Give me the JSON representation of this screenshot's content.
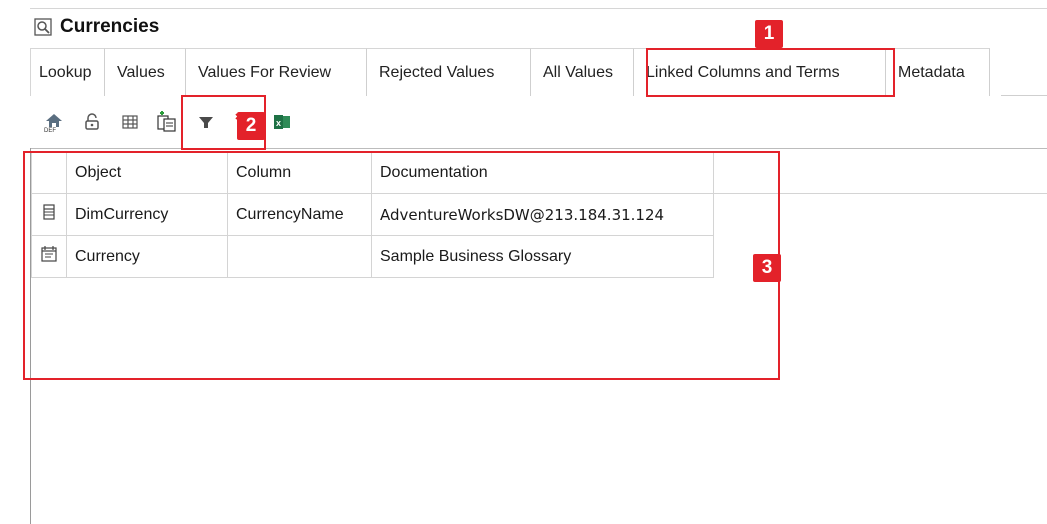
{
  "window": {
    "title": "Currencies",
    "title_icon": "search-document-icon"
  },
  "tabs": [
    {
      "label": "Lookup"
    },
    {
      "label": "Values"
    },
    {
      "label": "Values For Review"
    },
    {
      "label": "Rejected Values"
    },
    {
      "label": "All Values"
    },
    {
      "label": "Linked Columns and Terms",
      "active": true
    },
    {
      "label": "Metadata"
    }
  ],
  "toolbar": {
    "buttons": [
      {
        "icon": "definition-home-icon"
      },
      {
        "icon": "lock-icon"
      },
      {
        "icon": "grid-icon"
      },
      {
        "icon": "link-copy-icon"
      },
      {
        "icon": "filter-icon"
      },
      {
        "icon": "clear-filter-icon"
      },
      {
        "icon": "excel-icon"
      }
    ]
  },
  "grid": {
    "columns": [
      "Object",
      "Column",
      "Documentation"
    ],
    "rows": [
      {
        "icon": "table-icon",
        "object": "DimCurrency",
        "column": "CurrencyName",
        "documentation": "AdventureWorksDW@213.184.31.124"
      },
      {
        "icon": "glossary-term-icon",
        "object": "Currency",
        "column": "",
        "documentation": "Sample Business Glossary"
      }
    ]
  },
  "callouts": [
    {
      "number": "1"
    },
    {
      "number": "2"
    },
    {
      "number": "3"
    }
  ],
  "colors": {
    "callout": "#e3222a",
    "excel_green": "#1e7145"
  }
}
